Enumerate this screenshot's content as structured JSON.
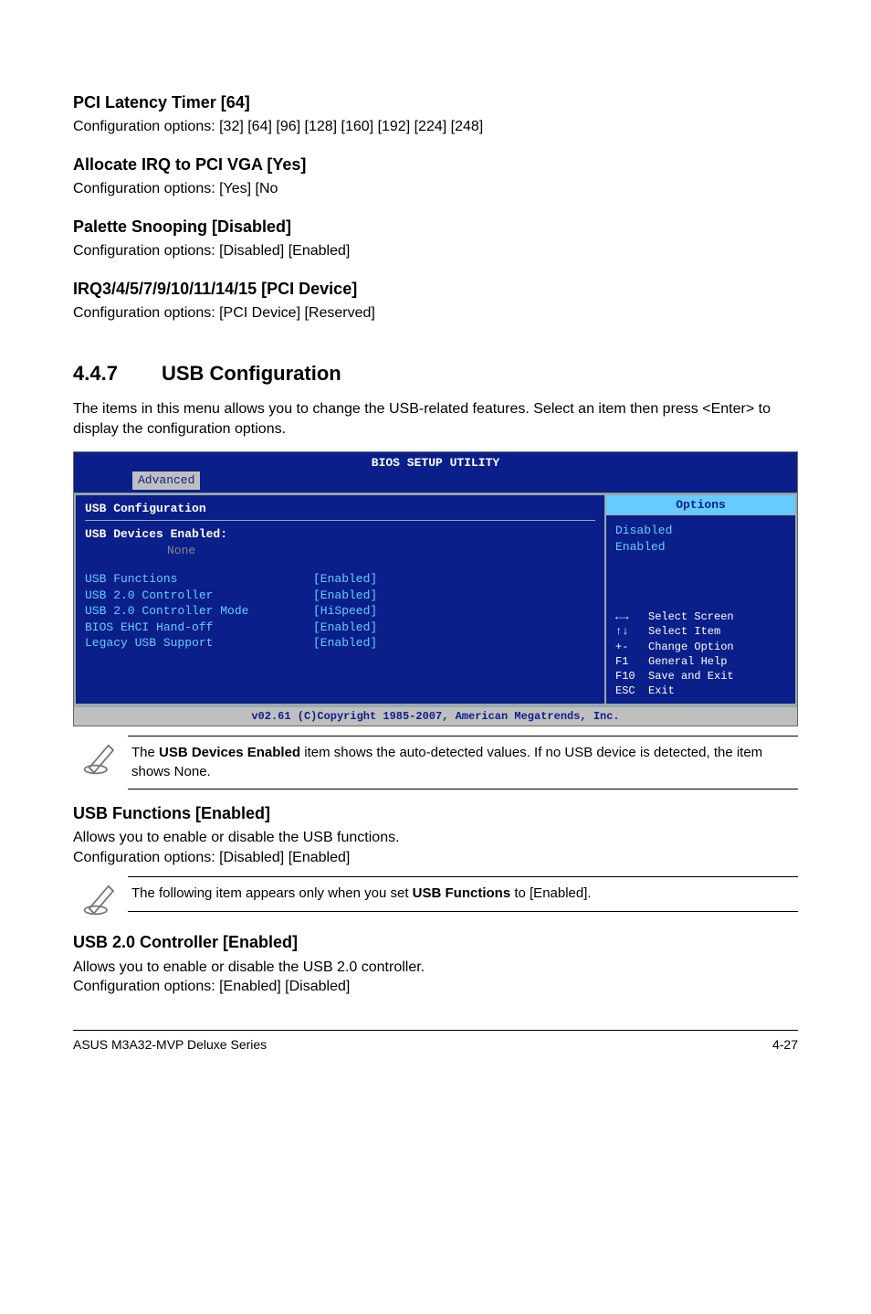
{
  "s1": {
    "title": "PCI Latency Timer [64]",
    "body": "Configuration options: [32] [64] [96] [128] [160] [192] [224] [248]"
  },
  "s2": {
    "title": "Allocate IRQ to PCI VGA [Yes]",
    "body": "Configuration options: [Yes] [No"
  },
  "s3": {
    "title": "Palette Snooping [Disabled]",
    "body": "Configuration options: [Disabled] [Enabled]"
  },
  "s4": {
    "title": "IRQ3/4/5/7/9/10/11/14/15 [PCI Device]",
    "body": "Configuration options: [PCI Device] [Reserved]"
  },
  "section": {
    "num": "4.4.7",
    "title": "USB Configuration",
    "desc": "The items in this menu allows you to change the USB-related features. Select an item then press <Enter> to display the configuration options."
  },
  "bios": {
    "header": "BIOS SETUP UTILITY",
    "tab": "Advanced",
    "left_title": "USB Configuration",
    "dev_enabled_label": "USB Devices Enabled:",
    "dev_enabled_value": "None",
    "rows": [
      {
        "label": "USB Functions",
        "value": "[Enabled]"
      },
      {
        "label": "USB 2.0 Controller",
        "value": "[Enabled]"
      },
      {
        "label": "USB 2.0 Controller Mode",
        "value": "[HiSpeed]"
      },
      {
        "label": "BIOS EHCI Hand-off",
        "value": "[Enabled]"
      },
      {
        "label": "Legacy USB Support",
        "value": "[Enabled]"
      }
    ],
    "options_title": "Options",
    "options": [
      "Disabled",
      "Enabled"
    ],
    "keys": [
      {
        "k": "←→",
        "d": "Select Screen"
      },
      {
        "k": "↑↓",
        "d": "Select Item"
      },
      {
        "k": "+-",
        "d": "Change Option"
      },
      {
        "k": "F1",
        "d": "General Help"
      },
      {
        "k": "F10",
        "d": "Save and Exit"
      },
      {
        "k": "ESC",
        "d": "Exit"
      }
    ],
    "footer": "v02.61 (C)Copyright 1985-2007, American Megatrends, Inc."
  },
  "note1_pre": "The ",
  "note1_bold": "USB Devices Enabled",
  "note1_post": " item shows the auto-detected values. If no USB device is detected, the item shows None.",
  "s5": {
    "title": "USB Functions [Enabled]",
    "line1": "Allows you to enable or disable the USB functions.",
    "line2": "Configuration options: [Disabled] [Enabled]"
  },
  "note2_pre": "The following item appears only when you set ",
  "note2_bold": "USB Functions",
  "note2_post": " to [Enabled].",
  "s6": {
    "title": "USB 2.0 Controller [Enabled]",
    "line1": "Allows you to enable or disable the USB 2.0 controller.",
    "line2": "Configuration options: [Enabled] [Disabled]"
  },
  "footer": {
    "left": "ASUS M3A32-MVP Deluxe Series",
    "right": "4-27"
  }
}
